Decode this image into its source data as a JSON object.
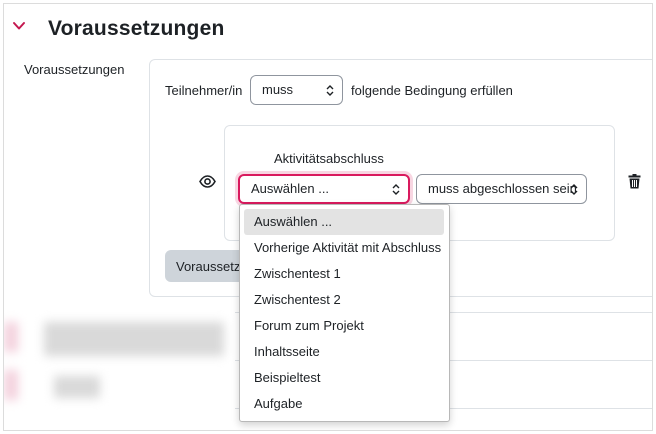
{
  "section": {
    "title": "Voraussetzungen"
  },
  "field": {
    "label": "Voraussetzungen"
  },
  "restriction_row": {
    "participant_label": "Teilnehmer/in",
    "must_select_value": "muss",
    "condition_label": "folgende Bedingung erfüllen"
  },
  "condition": {
    "type_label": "Aktivitätsabschluss",
    "activity_select_value": "Auswählen ...",
    "completion_select_value": "muss abgeschlossen sein"
  },
  "add_button_label": "Voraussetzung hinzufügen...",
  "dropdown": {
    "options": [
      "Auswählen ...",
      "Vorherige Aktivität mit Abschluss",
      "Zwischentest 1",
      "Zwischentest 2",
      "Forum zum Projekt",
      "Inhaltsseite",
      "Beispieltest",
      "Aufgabe"
    ],
    "selected_index": 0
  },
  "colors": {
    "accent": "#d91a5e",
    "chevron": "#c4184f",
    "button_bg": "#ced4da",
    "selected_option_bg": "#e3e3e3"
  },
  "icons": [
    "chevron-down-icon",
    "eye-icon",
    "trash-icon",
    "select-arrows-icon"
  ]
}
